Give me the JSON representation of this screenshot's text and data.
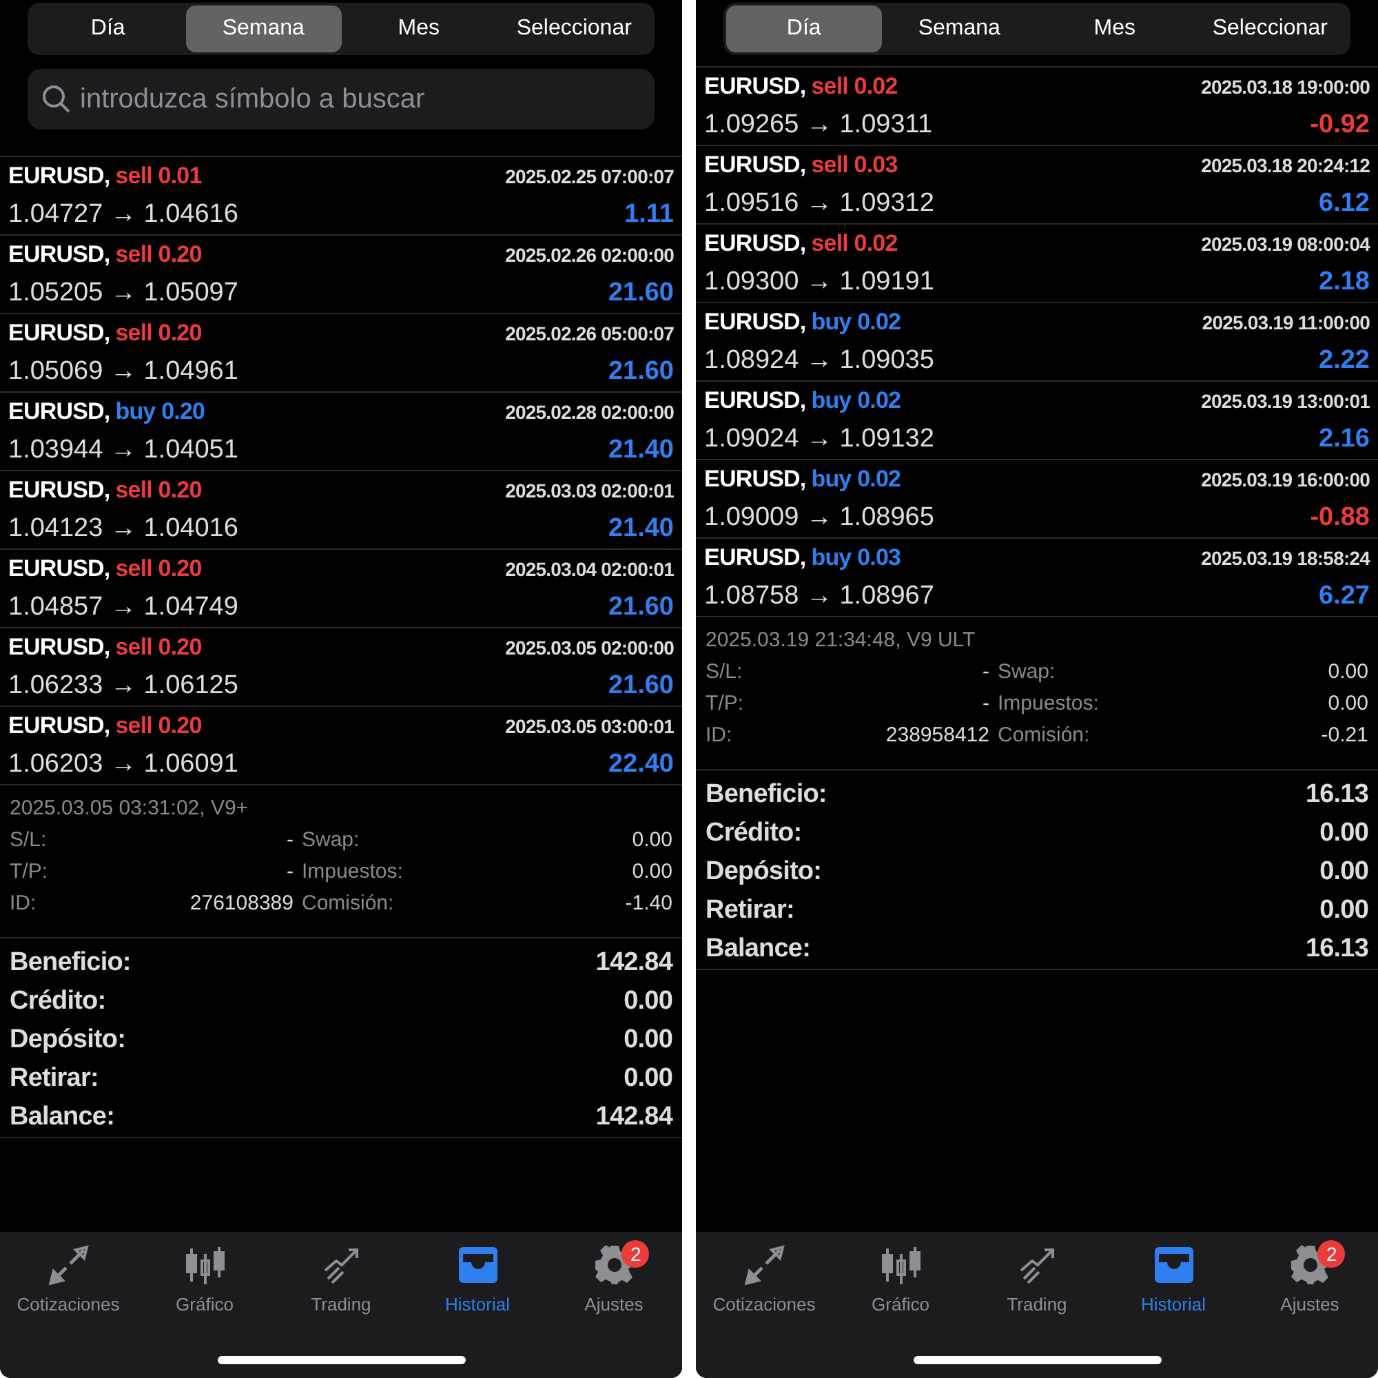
{
  "screens": [
    {
      "segments": [
        {
          "label": "Día",
          "selected": false
        },
        {
          "label": "Semana",
          "selected": true
        },
        {
          "label": "Mes",
          "selected": false
        },
        {
          "label": "Seleccionar",
          "selected": false
        }
      ],
      "search": {
        "placeholder": "introduzca símbolo a buscar"
      },
      "trades": [
        {
          "symbol": "EURUSD,",
          "kind": "sell",
          "order": "sell 0.01",
          "time": "2025.02.25 07:00:07",
          "prices": "1.04727 → 1.04616",
          "profit": "1.11",
          "loss": false
        },
        {
          "symbol": "EURUSD,",
          "kind": "sell",
          "order": "sell 0.20",
          "time": "2025.02.26 02:00:00",
          "prices": "1.05205 → 1.05097",
          "profit": "21.60",
          "loss": false
        },
        {
          "symbol": "EURUSD,",
          "kind": "sell",
          "order": "sell 0.20",
          "time": "2025.02.26 05:00:07",
          "prices": "1.05069 → 1.04961",
          "profit": "21.60",
          "loss": false
        },
        {
          "symbol": "EURUSD,",
          "kind": "buy",
          "order": "buy 0.20",
          "time": "2025.02.28 02:00:00",
          "prices": "1.03944 → 1.04051",
          "profit": "21.40",
          "loss": false
        },
        {
          "symbol": "EURUSD,",
          "kind": "sell",
          "order": "sell 0.20",
          "time": "2025.03.03 02:00:01",
          "prices": "1.04123 → 1.04016",
          "profit": "21.40",
          "loss": false
        },
        {
          "symbol": "EURUSD,",
          "kind": "sell",
          "order": "sell 0.20",
          "time": "2025.03.04 02:00:01",
          "prices": "1.04857 → 1.04749",
          "profit": "21.60",
          "loss": false
        },
        {
          "symbol": "EURUSD,",
          "kind": "sell",
          "order": "sell 0.20",
          "time": "2025.03.05 02:00:00",
          "prices": "1.06233 → 1.06125",
          "profit": "21.60",
          "loss": false
        },
        {
          "symbol": "EURUSD,",
          "kind": "sell",
          "order": "sell 0.20",
          "time": "2025.03.05 03:00:01",
          "prices": "1.06203 → 1.06091",
          "profit": "22.40",
          "loss": false
        }
      ],
      "detail_header": "2025.03.05 03:31:02, V9+",
      "details": [
        {
          "label": "S/L:",
          "value": "-",
          "label_2": "Swap:",
          "value_2": "0.00"
        },
        {
          "label": "T/P:",
          "value": "-",
          "label_2": "Impuestos:",
          "value_2": "0.00"
        },
        {
          "label": "ID:",
          "value": "276108389",
          "label_2": "Comisión:",
          "value_2": "-1.40"
        }
      ],
      "summary": [
        {
          "label": "Beneficio:",
          "value": "142.84"
        },
        {
          "label": "Crédito:",
          "value": "0.00"
        },
        {
          "label": "Depósito:",
          "value": "0.00"
        },
        {
          "label": "Retirar:",
          "value": "0.00"
        },
        {
          "label": "Balance:",
          "value": "142.84"
        }
      ],
      "tabbar": [
        {
          "kind": "quotes",
          "label": "Cotizaciones",
          "selected": false
        },
        {
          "kind": "chart",
          "label": "Gráfico",
          "selected": false
        },
        {
          "kind": "trading",
          "label": "Trading",
          "selected": false
        },
        {
          "kind": "history",
          "label": "Historial",
          "selected": true
        },
        {
          "kind": "settings",
          "label": "Ajustes",
          "selected": false,
          "badge": "2"
        }
      ]
    },
    {
      "segments": [
        {
          "label": "Día",
          "selected": true
        },
        {
          "label": "Semana",
          "selected": false
        },
        {
          "label": "Mes",
          "selected": false
        },
        {
          "label": "Seleccionar",
          "selected": false
        }
      ],
      "trades": [
        {
          "symbol": "EURUSD,",
          "kind": "sell",
          "order": "sell 0.02",
          "time": "2025.03.18 19:00:00",
          "prices": "1.09265 → 1.09311",
          "profit": "-0.92",
          "loss": true
        },
        {
          "symbol": "EURUSD,",
          "kind": "sell",
          "order": "sell 0.03",
          "time": "2025.03.18 20:24:12",
          "prices": "1.09516 → 1.09312",
          "profit": "6.12",
          "loss": false
        },
        {
          "symbol": "EURUSD,",
          "kind": "sell",
          "order": "sell 0.02",
          "time": "2025.03.19 08:00:04",
          "prices": "1.09300 → 1.09191",
          "profit": "2.18",
          "loss": false
        },
        {
          "symbol": "EURUSD,",
          "kind": "buy",
          "order": "buy 0.02",
          "time": "2025.03.19 11:00:00",
          "prices": "1.08924 → 1.09035",
          "profit": "2.22",
          "loss": false
        },
        {
          "symbol": "EURUSD,",
          "kind": "buy",
          "order": "buy 0.02",
          "time": "2025.03.19 13:00:01",
          "prices": "1.09024 → 1.09132",
          "profit": "2.16",
          "loss": false
        },
        {
          "symbol": "EURUSD,",
          "kind": "buy",
          "order": "buy 0.02",
          "time": "2025.03.19 16:00:00",
          "prices": "1.09009 → 1.08965",
          "profit": "-0.88",
          "loss": true
        },
        {
          "symbol": "EURUSD,",
          "kind": "buy",
          "order": "buy 0.03",
          "time": "2025.03.19 18:58:24",
          "prices": "1.08758 → 1.08967",
          "profit": "6.27",
          "loss": false
        }
      ],
      "detail_header": "2025.03.19 21:34:48, V9 ULT",
      "details": [
        {
          "label": "S/L:",
          "value": "-",
          "label_2": "Swap:",
          "value_2": "0.00"
        },
        {
          "label": "T/P:",
          "value": "-",
          "label_2": "Impuestos:",
          "value_2": "0.00"
        },
        {
          "label": "ID:",
          "value": "238958412",
          "label_2": "Comisión:",
          "value_2": "-0.21"
        }
      ],
      "summary": [
        {
          "label": "Beneficio:",
          "value": "16.13"
        },
        {
          "label": "Crédito:",
          "value": "0.00"
        },
        {
          "label": "Depósito:",
          "value": "0.00"
        },
        {
          "label": "Retirar:",
          "value": "0.00"
        },
        {
          "label": "Balance:",
          "value": "16.13"
        }
      ],
      "tabbar": [
        {
          "kind": "quotes",
          "label": "Cotizaciones",
          "selected": false
        },
        {
          "kind": "chart",
          "label": "Gráfico",
          "selected": false
        },
        {
          "kind": "trading",
          "label": "Trading",
          "selected": false
        },
        {
          "kind": "history",
          "label": "Historial",
          "selected": true
        },
        {
          "kind": "settings",
          "label": "Ajustes",
          "selected": false,
          "badge": "2"
        }
      ]
    }
  ]
}
